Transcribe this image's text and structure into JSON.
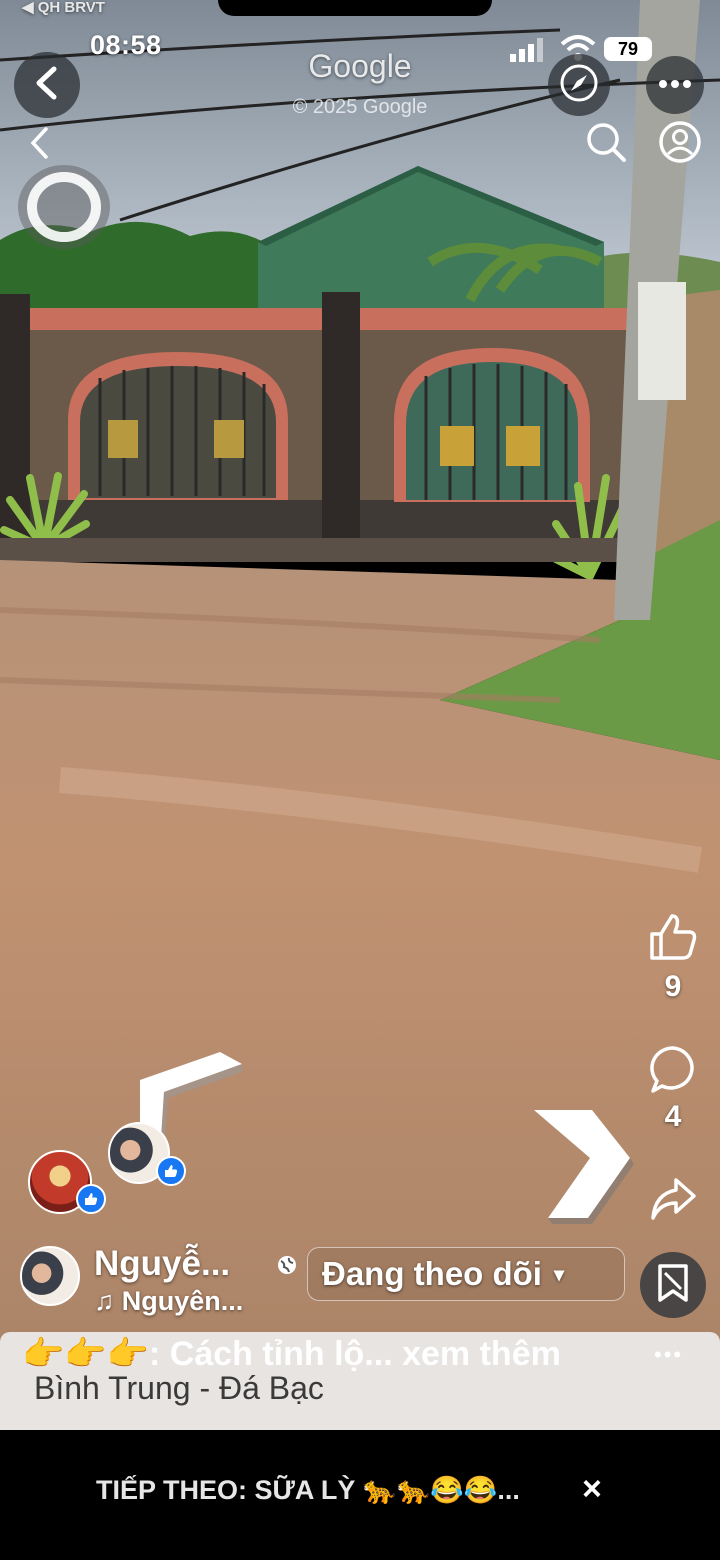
{
  "status_bar": {
    "carrier": "◀ QH BRVT",
    "time": "08:58",
    "battery": "79"
  },
  "street_view": {
    "brand": "Google",
    "copyright": "© 2025 Google"
  },
  "actions": {
    "like_count": "9",
    "comment_count": "4"
  },
  "reel": {
    "author_name": "Nguyễ...",
    "music": "♫ Nguyên...",
    "follow_label": "Đang theo dõi",
    "follow_caret": "▾",
    "caption_line1": "👉👉👉: Cách tỉnh lộ... xem thêm",
    "caption_line2": "Bình Trung - Đá Bạc",
    "more": "•••"
  },
  "next_up": {
    "label": "TIẾP THEO: SỮA LỲ 🐆🐆😂😂...",
    "close": "×"
  },
  "colors": {
    "like_badge": "#1877f2",
    "road": "#b88a66",
    "sky": "#aab6c4",
    "shed": "#3f7a5a"
  },
  "icons": [
    "back-arrow-icon",
    "chevron-left-icon",
    "compass-icon",
    "more-icon",
    "search-icon",
    "profile-icon",
    "pegman-ring-icon",
    "thumbs-up-icon",
    "comment-icon",
    "share-icon",
    "save-reel-icon",
    "nav-arrow-left-icon",
    "nav-arrow-right-icon",
    "close-icon"
  ]
}
